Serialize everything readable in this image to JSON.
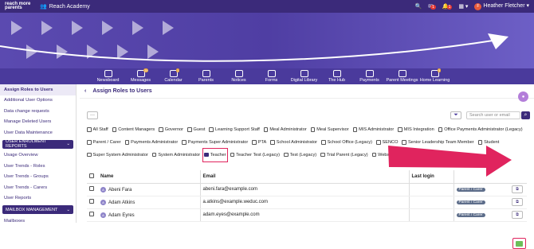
{
  "app": {
    "logo_line1": "reach more",
    "logo_line2": "parents",
    "school": "Reach Academy",
    "user": "Heather Fletcher",
    "user_initial": "F",
    "badges": {
      "messages": "1",
      "alerts": "1"
    }
  },
  "nav": [
    {
      "label": "Newsboard",
      "icon": "newspaper-icon",
      "badge": ""
    },
    {
      "label": "Messages",
      "icon": "envelope-icon",
      "badge": "25"
    },
    {
      "label": "Calendar",
      "icon": "calendar-icon",
      "badge": "1"
    },
    {
      "label": "Parents",
      "icon": "people-icon",
      "badge": ""
    },
    {
      "label": "Notices",
      "icon": "megaphone-icon",
      "badge": ""
    },
    {
      "label": "Forms",
      "icon": "form-icon",
      "badge": ""
    },
    {
      "label": "Digital Library",
      "icon": "book-icon",
      "badge": ""
    },
    {
      "label": "The Hub",
      "icon": "hub-icon",
      "badge": ""
    },
    {
      "label": "Payments",
      "icon": "payments-icon",
      "badge": ""
    },
    {
      "label": "Parent Meetings",
      "icon": "meetings-icon",
      "badge": ""
    },
    {
      "label": "Home Learning",
      "icon": "home-icon",
      "badge": "5"
    }
  ],
  "sidebar": {
    "items_top": [
      "Assign Roles to Users",
      "Additional User Options",
      "Data change requests",
      "Manage Deleted Users",
      "User Data Maintenance"
    ],
    "section1": "USER ENROLMENT REPORTS",
    "items_mid": [
      "Usage Overview",
      "User Trends - Roles",
      "User Trends - Groups",
      "User Trends - Carers",
      "User Reports"
    ],
    "section2": "MAILBOX MANAGEMENT",
    "items_bottom": [
      "Mailboxes"
    ]
  },
  "main": {
    "title": "Assign Roles to Users",
    "dots": "···",
    "search_placeholder": "Search user or email",
    "roles": [
      "All Staff",
      "Content Managers",
      "Governor",
      "Guest",
      "Learning Support Staff",
      "Meal Administrator",
      "Meal Supervisor",
      "MIS Administrator",
      "MIS Integration",
      "Office Payments Administrator (Legacy)",
      "Parent / Carer",
      "Payments Administrator",
      "Payments Super Administrator",
      "PTA",
      "School Administrator",
      "School Office (Legacy)",
      "SENCO",
      "Senior Leadership Team Member",
      "Student",
      "Super System Administrator",
      "System Administrator",
      "Teacher",
      "Teacher Test (Legacy)",
      "Test (Legacy)",
      "Trial Parent (Legacy)",
      "Website Integration"
    ],
    "checked_role": "Teacher",
    "table": {
      "headers": [
        "Name",
        "Email",
        "Last login"
      ],
      "rows": [
        {
          "initial": "A",
          "name": "Abeni Fara",
          "email": "abeni.fara@example.com",
          "last": "",
          "role": "Parent / Carer"
        },
        {
          "initial": "A",
          "name": "Adam Atkins",
          "email": "a.atkins@example.weduc.com",
          "last": "",
          "role": "Parent / Carer"
        },
        {
          "initial": "A",
          "name": "Adam Eyres",
          "email": "adam.eyes@example.com",
          "last": "",
          "role": "Parent / Carer"
        }
      ]
    }
  },
  "colors": {
    "brand": "#3b2a7a",
    "highlight": "#e0245e",
    "accent_green": "#6cbf5a"
  }
}
